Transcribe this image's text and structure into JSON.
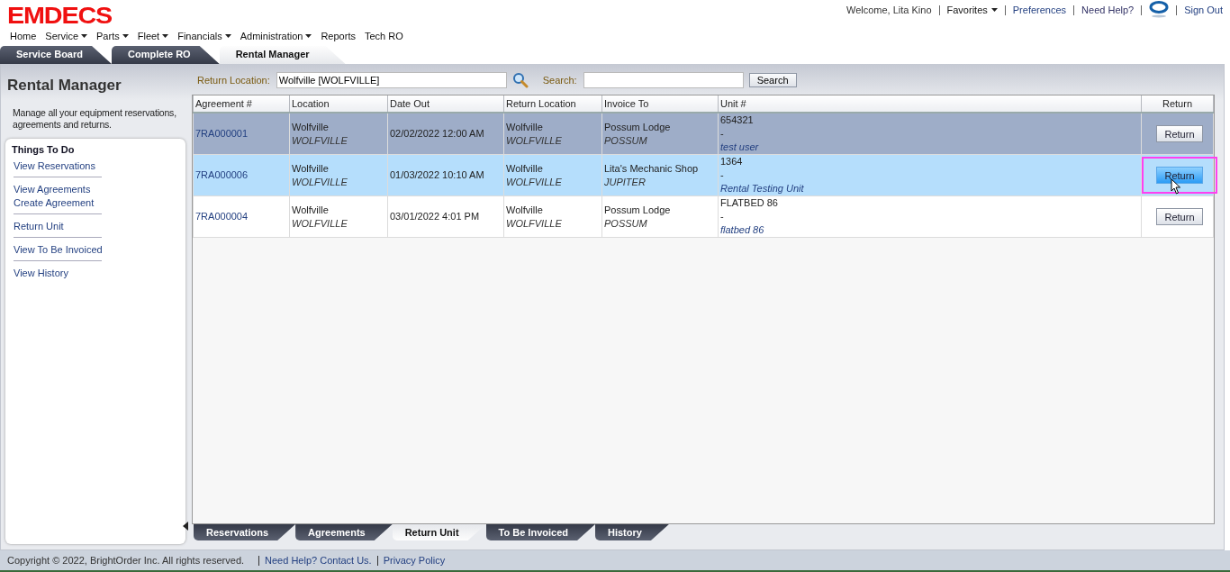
{
  "logo": "EMDECS",
  "nav": [
    {
      "label": "Home",
      "dropdown": false
    },
    {
      "label": "Service",
      "dropdown": true
    },
    {
      "label": "Parts",
      "dropdown": true
    },
    {
      "label": "Fleet",
      "dropdown": true
    },
    {
      "label": "Financials",
      "dropdown": true
    },
    {
      "label": "Administration",
      "dropdown": true
    },
    {
      "label": "Reports",
      "dropdown": false
    },
    {
      "label": "Tech RO",
      "dropdown": false
    }
  ],
  "user_bar": {
    "welcome": "Welcome, Lita Kino",
    "favorites": "Favorites",
    "preferences": "Preferences",
    "help": "Need Help?",
    "sign_out": "Sign Out"
  },
  "top_tabs": [
    {
      "label": "Service Board",
      "selected": false
    },
    {
      "label": "Complete RO",
      "selected": false
    },
    {
      "label": "Rental Manager",
      "selected": true
    }
  ],
  "sidebar": {
    "title": "Rental Manager",
    "description": "Manage all your equipment reservations, agreements and returns.",
    "things_title": "Things To Do",
    "groups": [
      [
        "View Reservations"
      ],
      [
        "View Agreements",
        "Create Agreement"
      ],
      [
        "Return Unit"
      ],
      [
        "View To Be Invoiced"
      ],
      [
        "View History"
      ]
    ]
  },
  "toolbar": {
    "return_location_label": "Return Location:",
    "return_location_value": "Wolfville [WOLFVILLE]",
    "search_label": "Search:",
    "search_button": "Search"
  },
  "table": {
    "columns": [
      "Agreement #",
      "Location",
      "Date Out",
      "Return Location",
      "Invoice To",
      "Unit #",
      "Return"
    ],
    "rows": [
      {
        "agreement": "7RA000001",
        "location": "Wolfville",
        "location_code": "WOLFVILLE",
        "date_out": "02/02/2022 12:00 AM",
        "return_location": "Wolfville",
        "return_location_code": "WOLFVILLE",
        "invoice_to": "Possum Lodge",
        "invoice_code": "POSSUM",
        "unit": "654321",
        "unit_sep": "-",
        "unit_desc": "test user",
        "button": "Return",
        "selected": true,
        "hovered": false
      },
      {
        "agreement": "7RA000006",
        "location": "Wolfville",
        "location_code": "WOLFVILLE",
        "date_out": "01/03/2022 10:10 AM",
        "return_location": "Wolfville",
        "return_location_code": "WOLFVILLE",
        "invoice_to": "Lita's Mechanic Shop",
        "invoice_code": "JUPITER",
        "unit": "1364",
        "unit_sep": "-",
        "unit_desc": "Rental Testing Unit",
        "button": "Return",
        "selected": false,
        "hovered": true
      },
      {
        "agreement": "7RA000004",
        "location": "Wolfville",
        "location_code": "WOLFVILLE",
        "date_out": "03/01/2022 4:01 PM",
        "return_location": "Wolfville",
        "return_location_code": "WOLFVILLE",
        "invoice_to": "Possum Lodge",
        "invoice_code": "POSSUM",
        "unit": "FLATBED 86",
        "unit_sep": "-",
        "unit_desc": "flatbed 86",
        "button": "Return",
        "selected": false,
        "hovered": false
      }
    ]
  },
  "bottom_tabs": [
    {
      "label": "Reservations",
      "selected": false
    },
    {
      "label": "Agreements",
      "selected": false
    },
    {
      "label": "Return Unit",
      "selected": true
    },
    {
      "label": "To Be Invoiced",
      "selected": false
    },
    {
      "label": "History",
      "selected": false
    }
  ],
  "footer": {
    "copyright": "Copyright © 2022, BrightOrder Inc. All rights reserved.",
    "contact": "Need Help? Contact Us.",
    "privacy": "Privacy Policy"
  }
}
